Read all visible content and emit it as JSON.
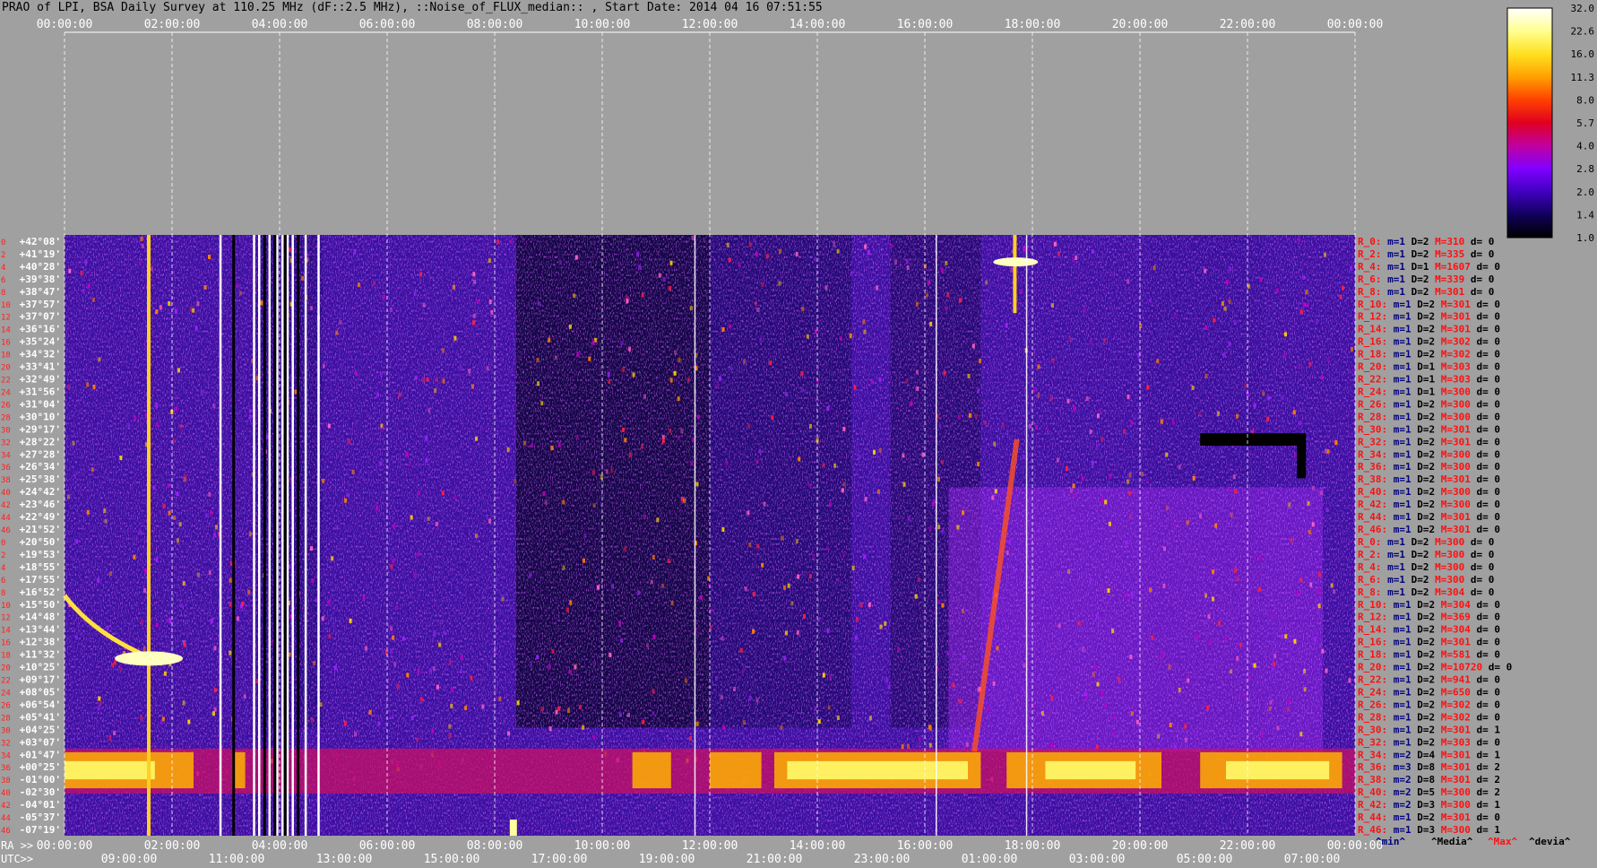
{
  "title": "PRAO of LPI, BSA Daily Survey at 110.25 MHz (dF::2.5 MHz), ::Noise_of_FLUX_median:: , Start Date: 2014 04 16 07:51:55",
  "colors": {
    "background": "#a0a0a0",
    "axis_text": "#ffffff",
    "red_text": "#ff0000",
    "blue_text": "#000080"
  },
  "chart_data": {
    "type": "heatmap",
    "x_top_ticks": [
      "00:00:00",
      "02:00:00",
      "04:00:00",
      "06:00:00",
      "08:00:00",
      "10:00:00",
      "12:00:00",
      "14:00:00",
      "16:00:00",
      "18:00:00",
      "20:00:00",
      "22:00:00",
      "00:00:00"
    ],
    "ra_prefix": "RA >>",
    "ra_ticks": [
      "00:00:00",
      "02:00:00",
      "04:00:00",
      "06:00:00",
      "08:00:00",
      "10:00:00",
      "12:00:00",
      "14:00:00",
      "16:00:00",
      "18:00:00",
      "20:00:00",
      "22:00:00",
      "00:00:00"
    ],
    "utc_prefix": "UTC>>",
    "utc_ticks": [
      "09:00:00",
      "11:00:00",
      "13:00:00",
      "15:00:00",
      "17:00:00",
      "19:00:00",
      "21:00:00",
      "23:00:00",
      "01:00:00",
      "03:00:00",
      "05:00:00",
      "07:00:00"
    ],
    "declinations": [
      "+42°08'",
      "+41°19'",
      "+40°28'",
      "+39°38'",
      "+38°47'",
      "+37°57'",
      "+37°07'",
      "+36°16'",
      "+35°24'",
      "+34°32'",
      "+33°41'",
      "+32°49'",
      "+31°56'",
      "+31°04'",
      "+30°10'",
      "+29°17'",
      "+28°22'",
      "+27°28'",
      "+26°34'",
      "+25°38'",
      "+24°42'",
      "+23°46'",
      "+22°49'",
      "+21°52'",
      "+20°50'",
      "+19°53'",
      "+18°55'",
      "+17°55'",
      "+16°52'",
      "+15°50'",
      "+14°48'",
      "+13°44'",
      "+12°38'",
      "+11°32'",
      "+10°25'",
      "+09°17'",
      "+08°05'",
      "+06°54'",
      "+05°41'",
      "+04°25'",
      "+03°07'",
      "+01°47'",
      "+00°25'",
      "-01°00'",
      "-02°30'",
      "-04°01'",
      "-05°37'",
      "-07°19'"
    ],
    "beam_numbers": [
      "0",
      "2",
      "4",
      "6",
      "8",
      "10",
      "12",
      "14",
      "16",
      "18",
      "20",
      "22",
      "24",
      "26",
      "28",
      "30",
      "32",
      "34",
      "36",
      "38",
      "40",
      "42",
      "44",
      "46",
      "0",
      "2",
      "4",
      "6",
      "8",
      "10",
      "12",
      "14",
      "16",
      "18",
      "20",
      "22",
      "24",
      "26",
      "28",
      "30",
      "32",
      "34",
      "36",
      "38",
      "40",
      "42",
      "44",
      "46"
    ],
    "rows": [
      {
        "r": "R_0:",
        "m": "m=1",
        "d": "D=2",
        "M": "M=310",
        "dd": "d= 0"
      },
      {
        "r": "R_2:",
        "m": "m=1",
        "d": "D=2",
        "M": "M=335",
        "dd": "d= 0"
      },
      {
        "r": "R_4:",
        "m": "m=1",
        "d": "D=1",
        "M": "M=1607",
        "dd": "d= 0"
      },
      {
        "r": "R_6:",
        "m": "m=1",
        "d": "D=2",
        "M": "M=339",
        "dd": "d= 0"
      },
      {
        "r": "R_8:",
        "m": "m=1",
        "d": "D=2",
        "M": "M=301",
        "dd": "d= 0"
      },
      {
        "r": "R_10:",
        "m": "m=1",
        "d": "D=2",
        "M": "M=301",
        "dd": "d= 0"
      },
      {
        "r": "R_12:",
        "m": "m=1",
        "d": "D=2",
        "M": "M=301",
        "dd": "d= 0"
      },
      {
        "r": "R_14:",
        "m": "m=1",
        "d": "D=2",
        "M": "M=301",
        "dd": "d= 0"
      },
      {
        "r": "R_16:",
        "m": "m=1",
        "d": "D=2",
        "M": "M=302",
        "dd": "d= 0"
      },
      {
        "r": "R_18:",
        "m": "m=1",
        "d": "D=2",
        "M": "M=302",
        "dd": "d= 0"
      },
      {
        "r": "R_20:",
        "m": "m=1",
        "d": "D=1",
        "M": "M=303",
        "dd": "d= 0"
      },
      {
        "r": "R_22:",
        "m": "m=1",
        "d": "D=1",
        "M": "M=303",
        "dd": "d= 0"
      },
      {
        "r": "R_24:",
        "m": "m=1",
        "d": "D=1",
        "M": "M=300",
        "dd": "d= 0"
      },
      {
        "r": "R_26:",
        "m": "m=1",
        "d": "D=2",
        "M": "M=300",
        "dd": "d= 0"
      },
      {
        "r": "R_28:",
        "m": "m=1",
        "d": "D=2",
        "M": "M=300",
        "dd": "d= 0"
      },
      {
        "r": "R_30:",
        "m": "m=1",
        "d": "D=2",
        "M": "M=301",
        "dd": "d= 0"
      },
      {
        "r": "R_32:",
        "m": "m=1",
        "d": "D=2",
        "M": "M=301",
        "dd": "d= 0"
      },
      {
        "r": "R_34:",
        "m": "m=1",
        "d": "D=2",
        "M": "M=300",
        "dd": "d= 0"
      },
      {
        "r": "R_36:",
        "m": "m=1",
        "d": "D=2",
        "M": "M=300",
        "dd": "d= 0"
      },
      {
        "r": "R_38:",
        "m": "m=1",
        "d": "D=2",
        "M": "M=301",
        "dd": "d= 0"
      },
      {
        "r": "R_40:",
        "m": "m=1",
        "d": "D=2",
        "M": "M=300",
        "dd": "d= 0"
      },
      {
        "r": "R_42:",
        "m": "m=1",
        "d": "D=2",
        "M": "M=300",
        "dd": "d= 0"
      },
      {
        "r": "R_44:",
        "m": "m=1",
        "d": "D=2",
        "M": "M=301",
        "dd": "d= 0"
      },
      {
        "r": "R_46:",
        "m": "m=1",
        "d": "D=2",
        "M": "M=301",
        "dd": "d= 0"
      },
      {
        "r": "R_0:",
        "m": "m=1",
        "d": "D=2",
        "M": "M=300",
        "dd": "d= 0"
      },
      {
        "r": "R_2:",
        "m": "m=1",
        "d": "D=2",
        "M": "M=300",
        "dd": "d= 0"
      },
      {
        "r": "R_4:",
        "m": "m=1",
        "d": "D=2",
        "M": "M=300",
        "dd": "d= 0"
      },
      {
        "r": "R_6:",
        "m": "m=1",
        "d": "D=2",
        "M": "M=300",
        "dd": "d= 0"
      },
      {
        "r": "R_8:",
        "m": "m=1",
        "d": "D=2",
        "M": "M=304",
        "dd": "d= 0"
      },
      {
        "r": "R_10:",
        "m": "m=1",
        "d": "D=2",
        "M": "M=304",
        "dd": "d= 0"
      },
      {
        "r": "R_12:",
        "m": "m=1",
        "d": "D=2",
        "M": "M=369",
        "dd": "d= 0"
      },
      {
        "r": "R_14:",
        "m": "m=1",
        "d": "D=2",
        "M": "M=304",
        "dd": "d= 0"
      },
      {
        "r": "R_16:",
        "m": "m=1",
        "d": "D=2",
        "M": "M=301",
        "dd": "d= 0"
      },
      {
        "r": "R_18:",
        "m": "m=1",
        "d": "D=2",
        "M": "M=581",
        "dd": "d= 0"
      },
      {
        "r": "R_20:",
        "m": "m=1",
        "d": "D=2",
        "M": "M=10720",
        "dd": "d= 0"
      },
      {
        "r": "R_22:",
        "m": "m=1",
        "d": "D=2",
        "M": "M=941",
        "dd": "d= 0"
      },
      {
        "r": "R_24:",
        "m": "m=1",
        "d": "D=2",
        "M": "M=650",
        "dd": "d= 0"
      },
      {
        "r": "R_26:",
        "m": "m=1",
        "d": "D=2",
        "M": "M=302",
        "dd": "d= 0"
      },
      {
        "r": "R_28:",
        "m": "m=1",
        "d": "D=2",
        "M": "M=302",
        "dd": "d= 0"
      },
      {
        "r": "R_30:",
        "m": "m=1",
        "d": "D=2",
        "M": "M=301",
        "dd": "d= 1"
      },
      {
        "r": "R_32:",
        "m": "m=1",
        "d": "D=2",
        "M": "M=303",
        "dd": "d= 0"
      },
      {
        "r": "R_34:",
        "m": "m=2",
        "d": "D=4",
        "M": "M=301",
        "dd": "d= 1"
      },
      {
        "r": "R_36:",
        "m": "m=3",
        "d": "D=8",
        "M": "M=301",
        "dd": "d= 2"
      },
      {
        "r": "R_38:",
        "m": "m=2",
        "d": "D=8",
        "M": "M=301",
        "dd": "d= 2"
      },
      {
        "r": "R_40:",
        "m": "m=2",
        "d": "D=5",
        "M": "M=300",
        "dd": "d= 2"
      },
      {
        "r": "R_42:",
        "m": "m=2",
        "d": "D=3",
        "M": "M=300",
        "dd": "d= 1"
      },
      {
        "r": "R_44:",
        "m": "m=1",
        "d": "D=2",
        "M": "M=301",
        "dd": "d= 0"
      },
      {
        "r": "R_46:",
        "m": "m=1",
        "d": "D=3",
        "M": "M=300",
        "dd": "d= 1"
      }
    ],
    "legend_labels": {
      "min": "^min^",
      "median": "^Media^",
      "max": "^Max^",
      "devia": "^devia^"
    },
    "colorbar": {
      "ticks": [
        "32.0",
        "22.6",
        "16.0",
        "11.3",
        "8.0",
        "5.7",
        "4.0",
        "2.8",
        "2.0",
        "1.4",
        "1.0"
      ],
      "stops": [
        "#ffffff",
        "#ffff90",
        "#ffe020",
        "#ffa000",
        "#ff4000",
        "#e00020",
        "#c000a0",
        "#8000ff",
        "#4000c0",
        "#10005a",
        "#000000"
      ]
    }
  }
}
